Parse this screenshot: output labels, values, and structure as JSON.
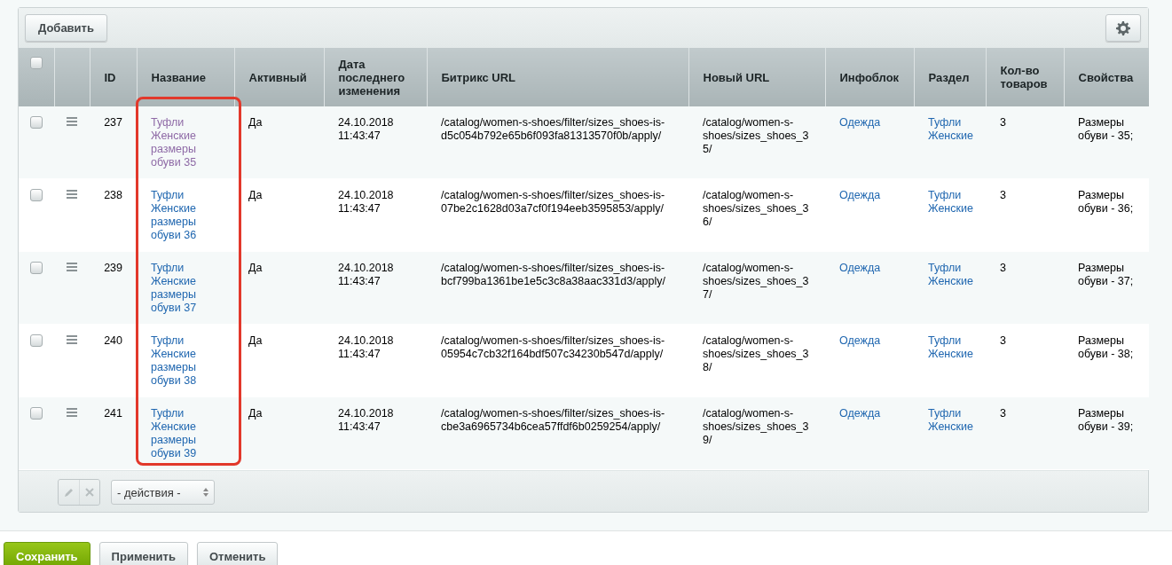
{
  "toolbar": {
    "add_button": "Добавить"
  },
  "table": {
    "select_all_checked": false,
    "columns": [
      "ID",
      "Название",
      "Активный",
      "Дата последнего изменения",
      "Битрикс URL",
      "Новый URL",
      "Инфоблок",
      "Раздел",
      "Кол-во товаров",
      "Свойства"
    ],
    "rows": [
      {
        "checked": false,
        "id": "237",
        "name": "Туфли Женские размеры обуви 35",
        "name_visited": true,
        "active": "Да",
        "date": "24.10.2018 11:43:47",
        "bitrix_url": "/catalog/women-s-shoes/filter/sizes_shoes-is-d5c054b792e65b6f093fa81313570f0b/apply/",
        "new_url": "/catalog/women-s-shoes/sizes_shoes_35/",
        "infoblock": "Одежда",
        "section": "Туфли Женские",
        "count": "3",
        "properties": "Размеры обуви - 35;"
      },
      {
        "checked": false,
        "id": "238",
        "name": "Туфли Женские размеры обуви 36",
        "name_visited": false,
        "active": "Да",
        "date": "24.10.2018 11:43:47",
        "bitrix_url": "/catalog/women-s-shoes/filter/sizes_shoes-is-07be2c1628d03a7cf0f194eeb3595853/apply/",
        "new_url": "/catalog/women-s-shoes/sizes_shoes_36/",
        "infoblock": "Одежда",
        "section": "Туфли Женские",
        "count": "3",
        "properties": "Размеры обуви - 36;"
      },
      {
        "checked": false,
        "id": "239",
        "name": "Туфли Женские размеры обуви 37",
        "name_visited": false,
        "active": "Да",
        "date": "24.10.2018 11:43:47",
        "bitrix_url": "/catalog/women-s-shoes/filter/sizes_shoes-is-bcf799ba1361be1e5c3c8a38aac331d3/apply/",
        "new_url": "/catalog/women-s-shoes/sizes_shoes_37/",
        "infoblock": "Одежда",
        "section": "Туфли Женские",
        "count": "3",
        "properties": "Размеры обуви - 37;"
      },
      {
        "checked": false,
        "id": "240",
        "name": "Туфли Женские размеры обуви 38",
        "name_visited": false,
        "active": "Да",
        "date": "24.10.2018 11:43:47",
        "bitrix_url": "/catalog/women-s-shoes/filter/sizes_shoes-is-05954c7cb32f164bdf507c34230b547d/apply/",
        "new_url": "/catalog/women-s-shoes/sizes_shoes_38/",
        "infoblock": "Одежда",
        "section": "Туфли Женские",
        "count": "3",
        "properties": "Размеры обуви - 38;"
      },
      {
        "checked": false,
        "id": "241",
        "name": "Туфли Женские размеры обуви 39",
        "name_visited": false,
        "active": "Да",
        "date": "24.10.2018 11:43:47",
        "bitrix_url": "/catalog/women-s-shoes/filter/sizes_shoes-is-cbe3a6965734b6cea57ffdf6b0259254/apply/",
        "new_url": "/catalog/women-s-shoes/sizes_shoes_39/",
        "infoblock": "Одежда",
        "section": "Туфли Женские",
        "count": "3",
        "properties": "Размеры обуви - 39;"
      }
    ]
  },
  "footer": {
    "edit_disabled": true,
    "delete_disabled": true,
    "actions_select": "- действия -"
  },
  "buttons": [
    {
      "label": "Сохранить",
      "kind": "primary"
    },
    {
      "label": "Применить",
      "kind": "default"
    },
    {
      "label": "Отменить",
      "kind": "default"
    }
  ]
}
